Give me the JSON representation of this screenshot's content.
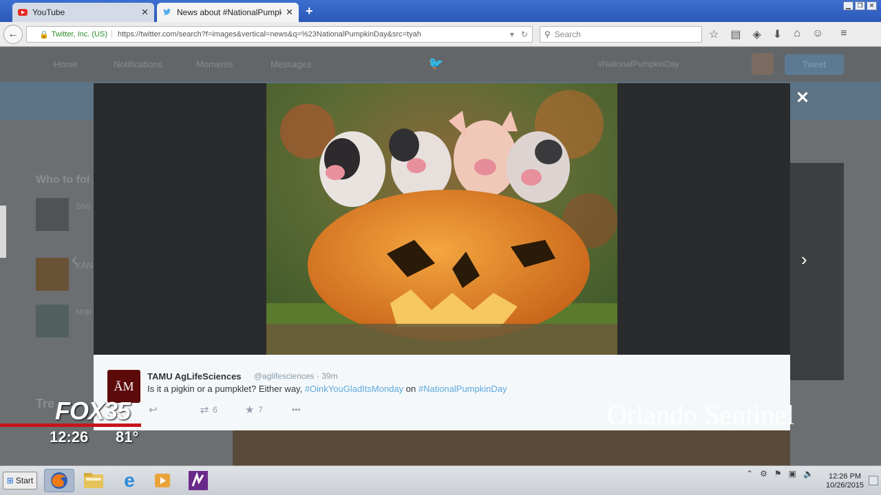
{
  "browser": {
    "tabs": [
      {
        "title": "YouTube",
        "close": "✕"
      },
      {
        "title": "News about #NationalPumpkinDay",
        "close": "✕"
      }
    ],
    "new_tab": "+",
    "url": {
      "org": "Twitter, Inc. (US)",
      "address": "https://twitter.com/search?f=images&vertical=news&q=%23NationalPumpkinDay&src=tyah"
    },
    "search_placeholder": "Search"
  },
  "twitter_page": {
    "nav": [
      "Home",
      "Notifications",
      "Moments",
      "Messages"
    ],
    "search_value": "#NationalPumpkinDay",
    "tweet_button": "Tweet",
    "who_to_follow": "Who to fol",
    "suggestions": [
      "Sho",
      "KAN",
      "stop"
    ],
    "trends_label": "Tre"
  },
  "lightbox": {
    "tweet": {
      "name": "TAMU AgLifeSciences",
      "handle": "@aglifesciences",
      "time": "· 39m",
      "text_plain": "Is it a pigkin or a pumpklet? Either way, ",
      "hashtag1": "#OinkYouGladItsMonday",
      "on": " on ",
      "hashtag2": "#NationalPumpkinDay",
      "retweets": "6",
      "likes": "7",
      "more": "•••"
    },
    "close": "✕",
    "next": "›",
    "prev": "‹"
  },
  "tv_overlay": {
    "channel": "FOX35",
    "time": "12:26",
    "temp": "81°",
    "watermark": "Orlando Sentinel"
  },
  "taskbar": {
    "start": "Start",
    "clock_time": "12:26 PM",
    "clock_date": "10/26/2015"
  },
  "colors": {
    "hashtag": "#5ea9dd",
    "accent_red": "#c8141a"
  }
}
